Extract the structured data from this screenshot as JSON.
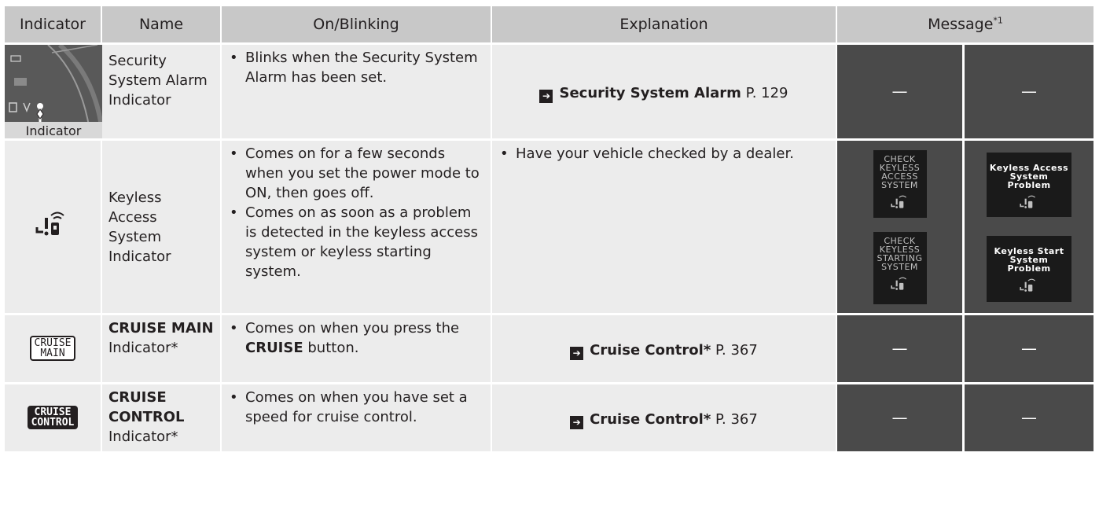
{
  "headers": {
    "indicator": "Indicator",
    "name": "Name",
    "on_blinking": "On/Blinking",
    "explanation": "Explanation",
    "message": "Message*1"
  },
  "rows": [
    {
      "name": "Security System Alarm Indicator",
      "name_bold": "",
      "name_rest": "",
      "on_blinking": [
        "Blinks when the Security System Alarm has been set."
      ],
      "on_blinking_bold": "",
      "explanation_ref_title": "Security System Alarm",
      "explanation_ref_page": "P. 129",
      "indicator_caption": "Indicator",
      "message_1": "—",
      "message_2": "—"
    },
    {
      "name": "Keyless Access System Indicator",
      "on_blinking": [
        "Comes on for a few seconds when you set the power mode to ON, then goes off.",
        "Comes on as soon as a problem is detected in the keyless access system or keyless starting system."
      ],
      "explanation": "Have your vehicle checked by a dealer.",
      "screens": {
        "screen_1": "CHECK KEYLESS ACCESS SYSTEM",
        "screen_2": "Keyless Access System Problem",
        "screen_3": "CHECK KEYLESS STARTING SYSTEM",
        "screen_4": "Keyless Start System Problem"
      },
      "icon": "keyless-warning-icon"
    },
    {
      "name_bold": "CRUISE MAIN",
      "name_rest": "Indicator*",
      "on_prefix": "Comes on when you press the ",
      "on_bold": "CRUISE",
      "on_suffix": " button.",
      "explanation_ref_title": "Cruise Control*",
      "explanation_ref_page": "P. 367",
      "icon_text": "CRUISE MAIN",
      "message_1": "—",
      "message_2": "—"
    },
    {
      "name_bold": "CRUISE CONTROL",
      "name_rest": "Indicator*",
      "on_blinking": [
        "Comes on when you have set a speed for cruise control."
      ],
      "explanation_ref_title": "Cruise Control*",
      "explanation_ref_page": "P. 367",
      "icon_text": "CRUISE CONTROL",
      "message_1": "—",
      "message_2": "—"
    }
  ]
}
